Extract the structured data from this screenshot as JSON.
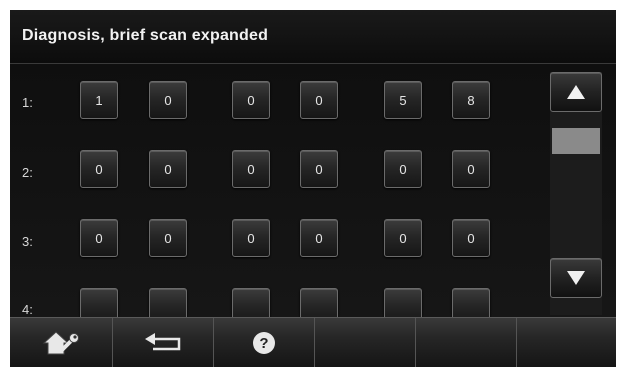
{
  "title": "Diagnosis, brief scan expanded",
  "rows": [
    {
      "label": "1:",
      "values": [
        "1",
        "0",
        "0",
        "0",
        "5",
        "8"
      ]
    },
    {
      "label": "2:",
      "values": [
        "0",
        "0",
        "0",
        "0",
        "0",
        "0"
      ]
    },
    {
      "label": "3:",
      "values": [
        "0",
        "0",
        "0",
        "0",
        "0",
        "0"
      ]
    },
    {
      "label": "4:",
      "values": [
        "",
        "",
        "",
        "",
        "",
        ""
      ]
    }
  ],
  "bottom_bar": {
    "tabs": [
      {
        "name": "settings-home",
        "icon": "house-wrench-icon"
      },
      {
        "name": "back",
        "icon": "back-arrow-icon"
      },
      {
        "name": "help",
        "icon": "question-icon",
        "text": "?"
      },
      {
        "name": "empty-1",
        "icon": ""
      },
      {
        "name": "empty-2",
        "icon": ""
      },
      {
        "name": "empty-3",
        "icon": ""
      }
    ]
  },
  "scroll": {
    "up_icon": "triangle-up-icon",
    "down_icon": "triangle-down-icon"
  },
  "colors": {
    "background": "#0a0a0a",
    "text": "#e6e6e6",
    "scroll_thumb": "#8a8a8a"
  }
}
